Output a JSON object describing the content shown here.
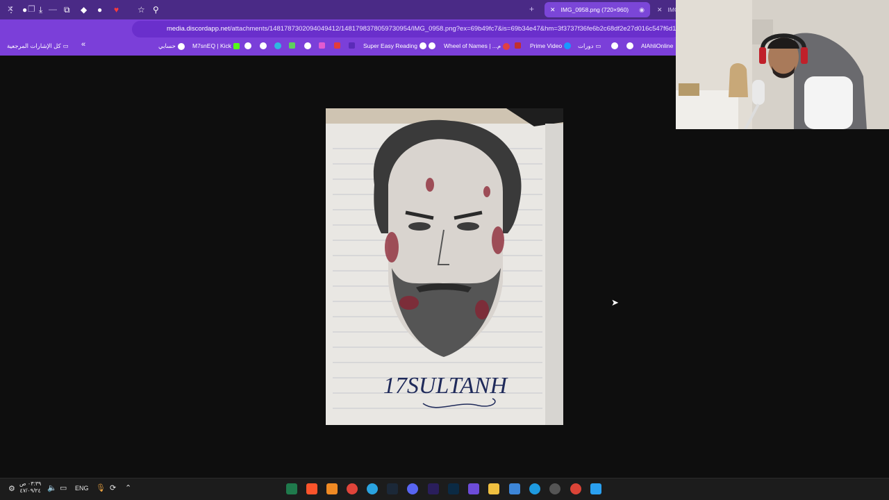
{
  "browser": {
    "active_tab_title": "IMG_0958.png (720×960)",
    "second_tab_title": "IMG",
    "url_host": "media.discordapp.net",
    "url_path": "/attachments/1481787302094049412/1481798378059730954/IMG_0958.png?ex=69b49fc7&is=69b34e47&hm=3f3737f36fe6b2c68df2e27d016c547f6d1b93"
  },
  "bookmarks": {
    "all_bookmarks": "كل الإشارات المرجعية",
    "expand": "«",
    "items": [
      "حسابي",
      "M7snEQ | Kick",
      "Super Easy Reading",
      "Wheel of Names | ...م",
      "Prime Video",
      "دورات",
      "AlAhliOnline"
    ]
  },
  "image": {
    "signature": "17SULTANH"
  },
  "taskbar": {
    "time": "٠٣:٣٩ ص",
    "date": "٤٧/٠٩/٢٤",
    "language": "ENG"
  },
  "colors": {
    "frame": "#4a2a86",
    "toolbar": "#7b3fd9",
    "tab_active": "#7b46d8",
    "page_bg": "#0e0e0e",
    "taskbar": "#1c1c1c"
  }
}
